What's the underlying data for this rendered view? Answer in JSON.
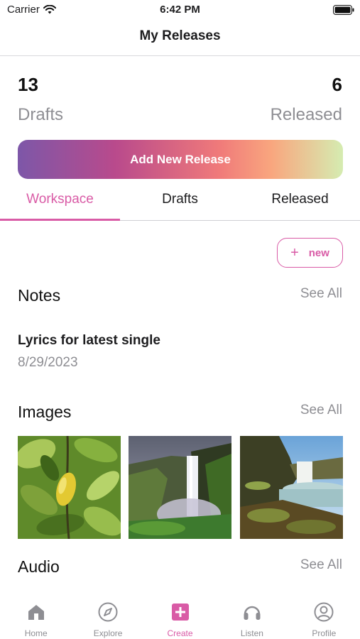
{
  "status_bar": {
    "carrier": "Carrier",
    "time": "6:42 PM",
    "icons": [
      "wifi-icon",
      "battery-icon"
    ]
  },
  "nav": {
    "title": "My Releases"
  },
  "stats": {
    "drafts_count": "13",
    "drafts_label": "Drafts",
    "released_count": "6",
    "released_label": "Released"
  },
  "add_release_label": "Add New Release",
  "tabs": [
    {
      "label": "Workspace",
      "active": true
    },
    {
      "label": "Drafts",
      "active": false
    },
    {
      "label": "Released",
      "active": false
    }
  ],
  "new_button": {
    "label": "new",
    "icon": "plus-icon"
  },
  "notes": {
    "title": "Notes",
    "see_all": "See All",
    "items": [
      {
        "title": "Lyrics for latest single",
        "date": "8/29/2023"
      }
    ]
  },
  "images": {
    "title": "Images",
    "see_all": "See All",
    "thumbnails": [
      "lemon-tree-leaves",
      "waterfall-cliff",
      "waterfall-coast"
    ]
  },
  "audio": {
    "title": "Audio",
    "see_all": "See All"
  },
  "tab_bar": [
    {
      "label": "Home",
      "icon": "home-icon",
      "active": false
    },
    {
      "label": "Explore",
      "icon": "compass-icon",
      "active": false
    },
    {
      "label": "Create",
      "icon": "plus-square-icon",
      "active": true
    },
    {
      "label": "Listen",
      "icon": "headphones-icon",
      "active": false
    },
    {
      "label": "Profile",
      "icon": "person-circle-icon",
      "active": false
    }
  ],
  "colors": {
    "accent": "#d95ba6",
    "secondary_text": "#8e8e93",
    "gradient": [
      "#7d57a8",
      "#b94a8c",
      "#f07a7a",
      "#f9a67e",
      "#d5ecb1"
    ]
  }
}
